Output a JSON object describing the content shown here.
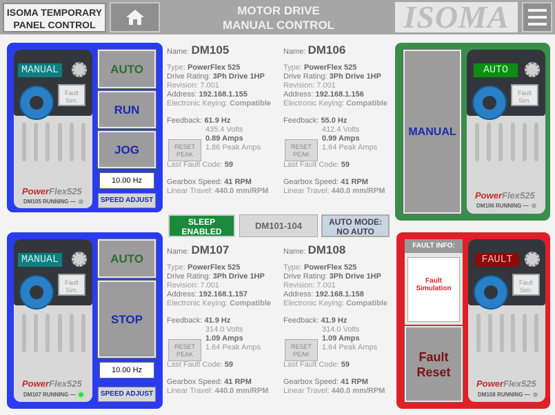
{
  "header": {
    "panel_title": "ISOMA TEMPORARY PANEL CONTROL",
    "title_line1": "MOTOR DRIVE",
    "title_line2": "MANUAL CONTROL",
    "logo": "ISOMA"
  },
  "controls": {
    "sleep": "SLEEP ENABLED",
    "range": "DM101-104",
    "auto_mode": "AUTO MODE: NO AUTO"
  },
  "drives": {
    "dm105": {
      "mode": "MANUAL",
      "fault_sim": "Fault Sim.",
      "brand1": "Power",
      "brand2": "Flex525",
      "status": "DM105 RUNNING",
      "btn1": "AUTO",
      "btn2": "RUN",
      "btn3": "JOG",
      "hz": "10.00 Hz",
      "speed": "SPEED ADJUST",
      "name_label": "Name:",
      "name": "DM105",
      "type_label": "Type:",
      "type": "PowerFlex 525",
      "rating_label": "Drive Rating:",
      "rating": "3Ph Drive 1HP",
      "revision_label": "Revision:",
      "revision": "7.001",
      "address_label": "Address:",
      "address": "192.168.1.155",
      "keying_label": "Electronic Keying:",
      "keying": "Compatible",
      "feedback_label": "Feedback:",
      "feedback": "61.9 Hz",
      "volts": "435.4 Volts",
      "amps": "0.89 Amps",
      "peak": "1.86 Peak Amps",
      "reset": "RESET PEAK",
      "fault_label": "Last Fault Code:",
      "fault": "59",
      "gear_label": "Gearbox Speed:",
      "gear": "41 RPM",
      "linear_label": "Linear Travel:",
      "linear": "440.0 mm/RPM"
    },
    "dm106": {
      "mode": "AUTO",
      "fault_sim": "Fault Sim.",
      "brand1": "Power",
      "brand2": "Flex525",
      "status": "DM106 RUNNING",
      "btn1": "MANUAL",
      "name_label": "Name:",
      "name": "DM106",
      "type_label": "Type:",
      "type": "PowerFlex 525",
      "rating_label": "Drive Rating:",
      "rating": "3Ph Drive 1HP",
      "revision_label": "Revision:",
      "revision": "7.001",
      "address_label": "Address:",
      "address": "192.168.1.156",
      "keying_label": "Electronic Keying:",
      "keying": "Compatible",
      "feedback_label": "Feedback:",
      "feedback": "55.0 Hz",
      "volts": "412.4 Volts",
      "amps": "0.99 Amps",
      "peak": "1.64 Peak Amps",
      "reset": "RESET PEAK",
      "fault_label": "Last Fault Code:",
      "fault": "59",
      "gear_label": "Gearbox Speed:",
      "gear": "41 RPM",
      "linear_label": "Linear Travel:",
      "linear": "440.0 mm/RPM"
    },
    "dm107": {
      "mode": "MANUAL",
      "fault_sim": "Fault Sim.",
      "brand1": "Power",
      "brand2": "Flex525",
      "status": "DM107 RUNNING",
      "btn1": "AUTO",
      "btn2": "STOP",
      "hz": "10.00 Hz",
      "speed": "SPEED ADJUST",
      "name_label": "Name:",
      "name": "DM107",
      "type_label": "Type:",
      "type": "PowerFlex 525",
      "rating_label": "Drive Rating:",
      "rating": "3Ph Drive 1HP",
      "revision_label": "Revision:",
      "revision": "7.001",
      "address_label": "Address:",
      "address": "192.168.1.157",
      "keying_label": "Electronic Keying:",
      "keying": "Compatible",
      "feedback_label": "Feedback:",
      "feedback": "41.9 Hz",
      "volts": "314.0 Volts",
      "amps": "1.09 Amps",
      "peak": "1.64 Peak Amps",
      "reset": "RESET PEAK",
      "fault_label": "Last Fault Code:",
      "fault": "59",
      "gear_label": "Gearbox Speed:",
      "gear": "41 RPM",
      "linear_label": "Linear Travel:",
      "linear": "440.0 mm/RPM"
    },
    "dm108": {
      "mode": "FAULT",
      "fault_sim": "Fault Sim.",
      "brand1": "Power",
      "brand2": "Flex525",
      "status": "DM108 RUNNING",
      "fault_info": "FAULT INFO:",
      "fault_text": "Fault Simulation",
      "fault_reset": "Fault Reset",
      "name_label": "Name:",
      "name": "DM108",
      "type_label": "Type:",
      "type": "PowerFlex 525",
      "rating_label": "Drive Rating:",
      "rating": "3Ph Drive 1HP",
      "revision_label": "Revision:",
      "revision": "7.001",
      "address_label": "Address:",
      "address": "192.168.1.158",
      "keying_label": "Electronic Keying:",
      "keying": "Compatible",
      "feedback_label": "Feedback:",
      "feedback": "41.9 Hz",
      "volts": "314.0 Volts",
      "amps": "1.09 Amps",
      "peak": "1.64 Peak Amps",
      "reset": "RESET PEAK",
      "fault_label": "Last Fault Code:",
      "fault": "59",
      "gear_label": "Gearbox Speed:",
      "gear": "41 RPM",
      "linear_label": "Linear Travel:",
      "linear": "440.0 mm/RPM"
    }
  }
}
